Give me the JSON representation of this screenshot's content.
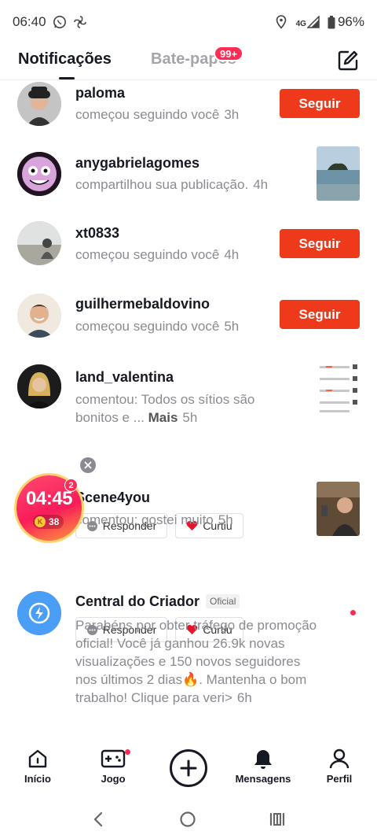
{
  "status_bar": {
    "time": "06:40",
    "network": "4G",
    "battery": "96%"
  },
  "header": {
    "tab_notifications": "Notificações",
    "tab_chats": "Bate-papos",
    "chat_badge": "99+"
  },
  "notifications": [
    {
      "username": "paloma",
      "text": "começou seguindo você",
      "time": "3h",
      "action": "Seguir"
    },
    {
      "username": "anygabrielagomes",
      "text": "compartilhou sua publicação.",
      "time": "4h"
    },
    {
      "username": "xt0833",
      "text": "começou seguindo você",
      "time": "4h",
      "action": "Seguir"
    },
    {
      "username": "guilhermebaldovino",
      "text": "começou seguindo você",
      "time": "5h",
      "action": "Seguir"
    },
    {
      "username": "land_valentina",
      "text_line1": "comentou: Todos os sítios são",
      "text_line2": "bonitos e ...",
      "more": "Mais",
      "time": "5h",
      "reply": "Responder",
      "liked": "Curtiu"
    },
    {
      "username": "Scene4you",
      "text": "comentou: gostei muito",
      "time": "5h",
      "reply": "Responder",
      "liked": "Curtiu"
    },
    {
      "username": "Central do Criador",
      "tag": "Oficial",
      "text": "Parabéns por obter tráfego de promoção oficial! Você já ganhou 26.9k novas visualizações e 150 novos seguidores nos últimos 2 dias🔥. Mantenha o bom trabalho! Clique para veri>",
      "time": "6h"
    }
  ],
  "timer_widget": {
    "time": "04:45",
    "coin_letter": "K",
    "coins": "38",
    "badge": "2"
  },
  "bottom_nav": {
    "home": "Início",
    "games": "Jogo",
    "messages": "Mensagens",
    "profile": "Perfil"
  },
  "colors": {
    "follow_button": "#ee3a1a",
    "badge": "#fe2c55",
    "creator_center": "#4a9ef5"
  }
}
